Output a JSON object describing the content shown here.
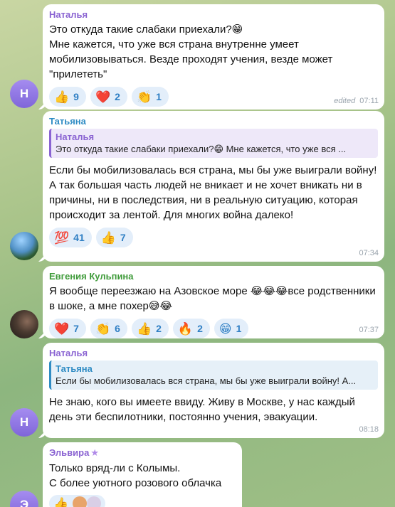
{
  "messages": [
    {
      "avatar_letter": "Н",
      "sender": "Наталья",
      "text": "Это откуда такие слабаки приехали?😁\nМне кажется, что уже вся страна внутренне умеет мобилизовываться. Везде проходят учения, везде может \"прилететь\"",
      "reactions": [
        {
          "emoji": "👍",
          "count": "9"
        },
        {
          "emoji": "❤️",
          "count": "2"
        },
        {
          "emoji": "👏",
          "count": "1"
        }
      ],
      "edited_label": "edited",
      "time": "07:11"
    },
    {
      "sender": "Татьяна",
      "reply": {
        "name": "Наталья",
        "text": "Это откуда такие слабаки приехали?😁 Мне кажется, что уже вся ..."
      },
      "text": "Если бы мобилизовалась вся страна, мы бы уже выиграли войну! А так большая часть людей не вникает и не хочет вникать ни в причины, ни в последствия, ни в реальную ситуацию, которая происходит за лентой. Для многих война далеко!",
      "reactions": [
        {
          "emoji": "💯",
          "count": "41"
        },
        {
          "emoji": "👍",
          "count": "7"
        }
      ],
      "time": "07:34"
    },
    {
      "sender": "Евгения Кульпина",
      "text": "Я вообще переезжаю на Азовское море 😂😂😂все родственники в шоке, а мне похер😅😂",
      "reactions": [
        {
          "emoji": "❤️",
          "count": "7"
        },
        {
          "emoji": "👏",
          "count": "6"
        },
        {
          "emoji": "👍",
          "count": "2"
        },
        {
          "emoji": "🔥",
          "count": "2"
        },
        {
          "emoji": "😁",
          "count": "1"
        }
      ],
      "time": "07:37"
    },
    {
      "avatar_letter": "Н",
      "sender": "Наталья",
      "reply": {
        "name": "Татьяна",
        "text": "Если бы мобилизовалась вся страна, мы бы уже выиграли войну! А..."
      },
      "text": "Не знаю, кого вы имеете ввиду. Живу в Москве, у нас каждый день эти беспилотники, постоянно учения, эвакуации.",
      "time": "08:18"
    },
    {
      "avatar_letter": "Э",
      "sender": "Эльвира",
      "sender_badge": "★",
      "text": "Только вряд-ли с Колымы.\nС более уютного розового облачка",
      "reactions": [
        {
          "emoji": "👍",
          "count": ""
        }
      ]
    }
  ]
}
